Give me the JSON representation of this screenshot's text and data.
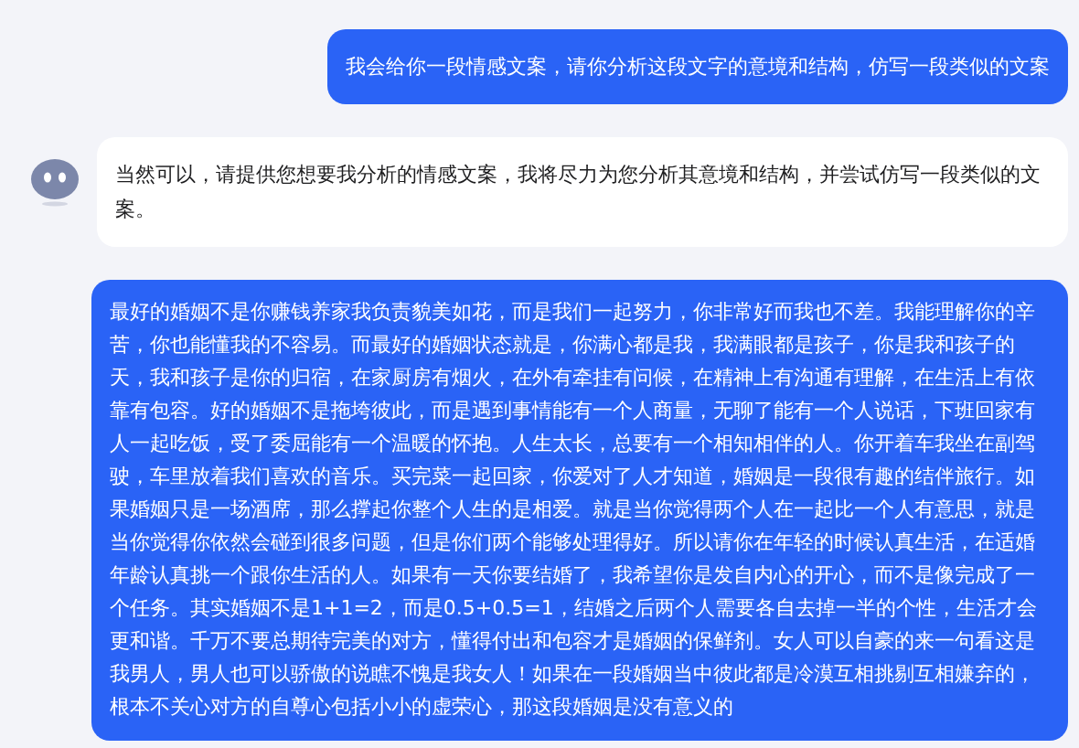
{
  "messages": [
    {
      "kind": "user",
      "text": "我会给你一段情感文案，请你分析这段文字的意境和结构，仿写一段类似的文案"
    },
    {
      "kind": "assistant",
      "text": "当然可以，请提供您想要我分析的情感文案，我将尽力为您分析其意境和结构，并尝试仿写一段类似的文案。"
    },
    {
      "kind": "user",
      "text": "最好的婚姻不是你赚钱养家我负责貌美如花，而是我们一起努力，你非常好而我也不差。我能理解你的辛苦，你也能懂我的不容易。而最好的婚姻状态就是，你满心都是我，我满眼都是孩子，你是我和孩子的天，我和孩子是你的归宿，在家厨房有烟火，在外有牵挂有问候，在精神上有沟通有理解，在生活上有依靠有包容。好的婚姻不是拖垮彼此，而是遇到事情能有一个人商量，无聊了能有一个人说话，下班回家有人一起吃饭，受了委屈能有一个温暖的怀抱。人生太长，总要有一个相知相伴的人。你开着车我坐在副驾驶，车里放着我们喜欢的音乐。买完菜一起回家，你爱对了人才知道，婚姻是一段很有趣的结伴旅行。如果婚姻只是一场酒席，那么撑起你整个人生的是相爱。就是当你觉得两个人在一起比一个人有意思，就是当你觉得你依然会碰到很多问题，但是你们两个能够处理得好。所以请你在年轻的时候认真生活，在适婚年龄认真挑一个跟你生活的人。如果有一天你要结婚了，我希望你是发自内心的开心，而不是像完成了一个任务。其实婚姻不是1+1=2，而是0.5+0.5=1，结婚之后两个人需要各自去掉一半的个性，生活才会更和谐。千万不要总期待完美的对方，懂得付出和包容才是婚姻的保鲜剂。女人可以自豪的来一句看这是我男人，男人也可以骄傲的说瞧不愧是我女人！如果在一段婚姻当中彼此都是冷漠互相挑剔互相嫌弃的，根本不关心对方的自尊心包括小小的虚荣心，那这段婚姻是没有意义的"
    }
  ]
}
